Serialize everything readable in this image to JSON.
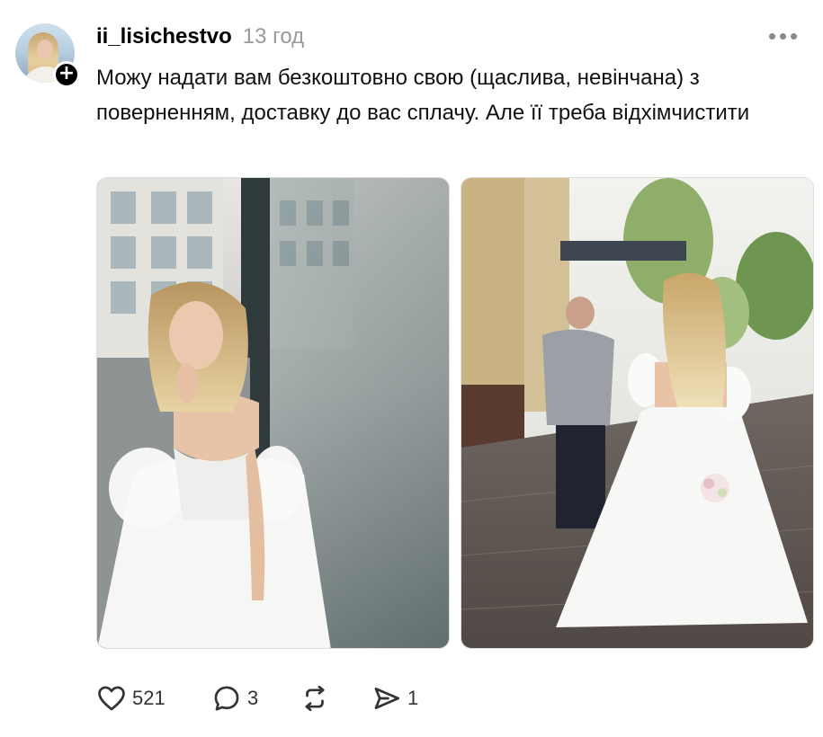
{
  "post": {
    "username": "ii_lisichestvo",
    "time": "13 год",
    "text": "Можу надати вам безкоштовно свою (щаслива, невінчана) з поверненням, доставку до вас сплачу. Але її треба відхімчистити",
    "follow_symbol": "+",
    "images": [
      {
        "alt": "bride-portrait-photo"
      },
      {
        "alt": "couple-walking-photo"
      }
    ]
  },
  "actions": {
    "likes": "521",
    "comments": "3",
    "shares": "1"
  },
  "icons": {
    "like": "heart-icon",
    "comment": "comment-bubble-icon",
    "repost": "repost-icon",
    "share": "send-icon",
    "more": "more-dots-icon"
  },
  "colors": {
    "text": "#000000",
    "muted": "#9a9a9a",
    "icon": "#333333"
  }
}
